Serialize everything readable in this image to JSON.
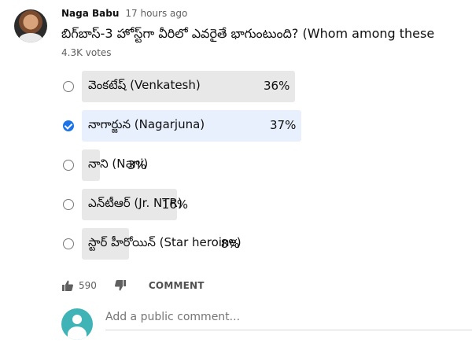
{
  "post": {
    "author": "Naga Babu",
    "time": "17 hours ago",
    "question": "బిగ్‌బాస్-3 హోస్ట్‌గా వీరిలో ఎవరైతే భాగుంటుంది? (Whom among these",
    "votes": "4.3K votes"
  },
  "poll": {
    "options": [
      {
        "label": "వెంకటేష్ (Venkatesh)",
        "percent_text": "36%",
        "percent": 36,
        "selected": false
      },
      {
        "label": "నాగార్జున (Nagarjuna)",
        "percent_text": "37%",
        "percent": 37,
        "selected": true
      },
      {
        "label": "నాని (Nani)",
        "percent_text": "3%",
        "percent": 3,
        "selected": false
      },
      {
        "label": "ఎన్‌టీఆర్ (Jr. NTR)",
        "percent_text": "16%",
        "percent": 16,
        "selected": false
      },
      {
        "label": "స్టార్ హీరోయిన్ (Star heroine)",
        "percent_text": "8%",
        "percent": 8,
        "selected": false
      }
    ]
  },
  "actions": {
    "like_count": "590",
    "comment_label": "COMMENT"
  },
  "comment_box": {
    "placeholder": "Add a public comment..."
  },
  "colors": {
    "bar": "#e8e8e8",
    "bar_selected": "#e8f0fe",
    "checked": "#1a73e8",
    "user_avatar": "#3fb3b6"
  }
}
